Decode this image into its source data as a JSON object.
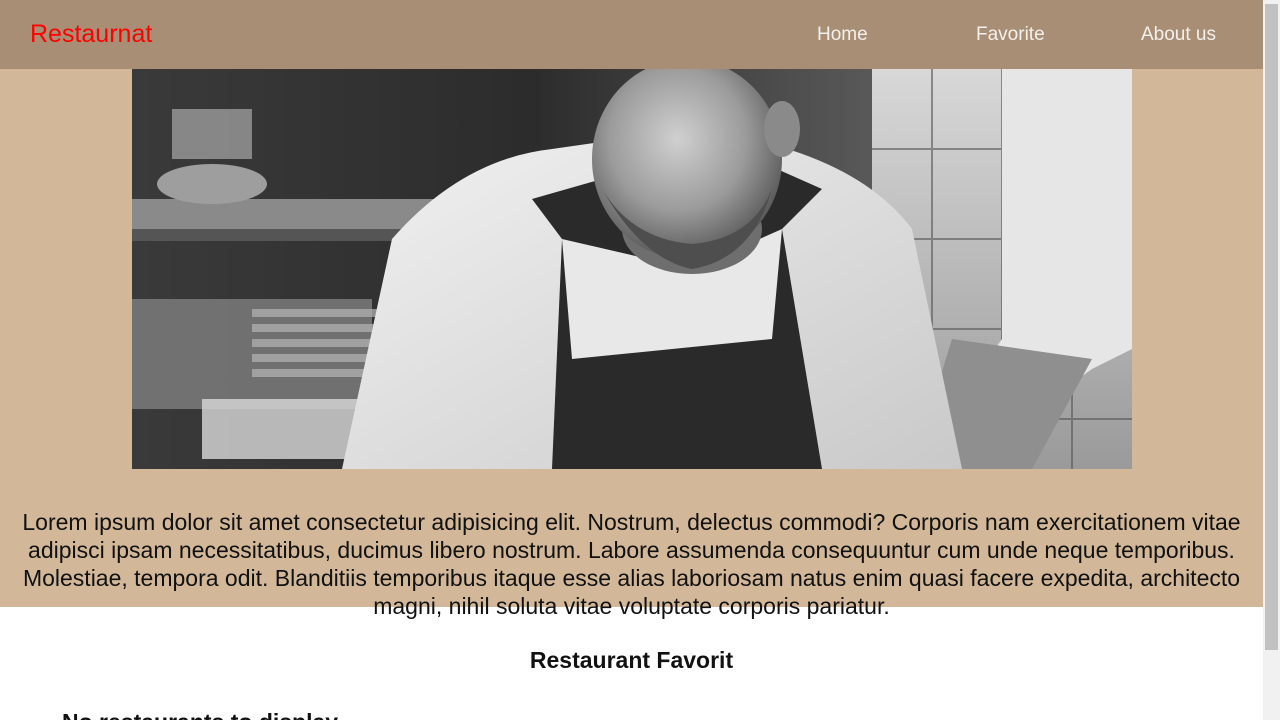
{
  "navbar": {
    "brand": "Restaurnat",
    "links": [
      {
        "label": "Home"
      },
      {
        "label": "Favorite"
      },
      {
        "label": "About us"
      }
    ]
  },
  "hero": {
    "description": "Lorem ipsum dolor sit amet consectetur adipisicing elit. Nostrum, delectus commodi? Corporis nam exercitationem vitae adipisci ipsam necessitatibus, ducimus libero nostrum. Labore assumenda consequuntur cum unde neque temporibus. Molestiae, tempora odit. Blanditiis temporibus itaque esse alias laboriosam natus enim quasi facere expedita, architecto magni, nihil soluta vitae voluptate corporis pariatur."
  },
  "favorites": {
    "title": "Restaurant Favorit",
    "empty_message": "No restaurants to display."
  },
  "colors": {
    "navbar_bg": "#a88e74",
    "hero_bg": "#d2b899",
    "brand": "#ff0000"
  }
}
